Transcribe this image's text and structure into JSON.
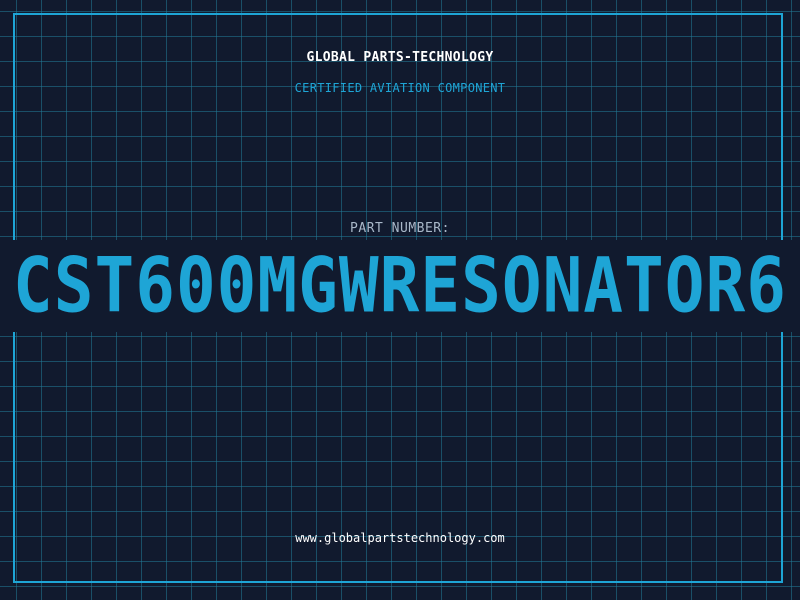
{
  "header": {
    "company": "GLOBAL PARTS-TECHNOLOGY",
    "tagline": "CERTIFIED AVIATION COMPONENT"
  },
  "part": {
    "label": "PART NUMBER:",
    "number": "CST600MGWRESONATOR6"
  },
  "footer": {
    "website": "www.globalpartstechnology.com"
  },
  "colors": {
    "background": "#111a2e",
    "grid": "#217a96",
    "accent": "#1ea5d6",
    "text": "#ffffff",
    "muted": "#a9b8c9"
  }
}
